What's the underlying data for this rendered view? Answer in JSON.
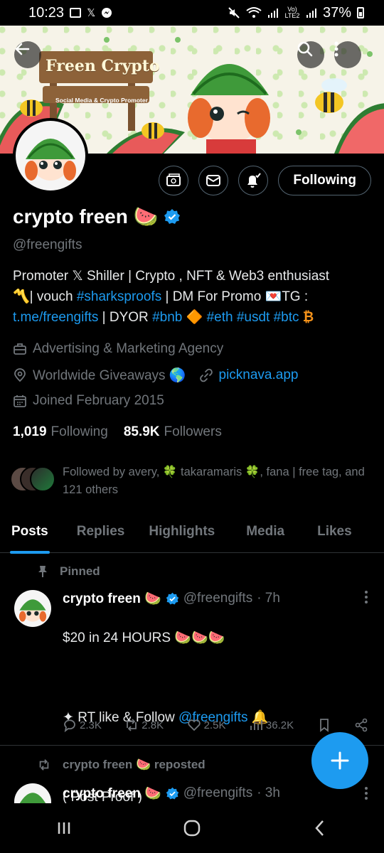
{
  "status_bar": {
    "time": "10:23",
    "carrier": "Vo) LTE2",
    "battery": "37%"
  },
  "banner": {
    "title": "Freen Crypto",
    "subtitle": "Social Media & Crypto Promoter"
  },
  "profile": {
    "display_name": "crypto freen 🍉",
    "handle": "@freengifts",
    "following_button": "Following",
    "bio_line1": "Promoter 𝕏 Shiller | Crypto , NFT & Web3 enthusiast",
    "bio_vouch_pre": "〽️| vouch ",
    "bio_vouch_tag": "#sharksproofs",
    "bio_vouch_post": " | DM For Promo 💌TG :",
    "bio_tg_link": "t.me/freengifts",
    "bio_dyor": " | DYOR ",
    "bio_tag_bnb": "#bnb",
    "bio_bnb_emoji": " 🔶 ",
    "bio_tag_eth": "#eth",
    "bio_tag_usdt": "#usdt",
    "bio_tag_btc": "#btc",
    "bio_btc_emoji": " ₿",
    "category": "Advertising & Marketing Agency",
    "location": "Worldwide Giveaways 🌎",
    "website": "picknava.app",
    "joined": "Joined February 2015",
    "following_count": "1,019",
    "following_label": "Following",
    "followers_count": "85.9K",
    "followers_label": "Followers",
    "followed_by": "Followed by avery, 🍀 takaramaris 🍀, fana | free tag, and 121 others"
  },
  "tabs": [
    "Posts",
    "Replies",
    "Highlights",
    "Media",
    "Likes"
  ],
  "posts": [
    {
      "context": "Pinned",
      "name": "crypto freen 🍉",
      "handle": "@freengifts",
      "time": "· 7h",
      "body_line1": "$20 in 24 HOURS 🍉🍉🍉",
      "body_line2_pre": "✦ RT like & Follow ",
      "body_line2_link": "@freengifts",
      "body_line2_post": " 🔔",
      "body_line3": "( Post Proof )",
      "replies": "2.3K",
      "reposts": "2.8K",
      "likes": "2.5K",
      "views": "36.2K"
    },
    {
      "context": "crypto freen 🍉 reposted",
      "name": "crypto freen 🍉",
      "handle": "@freengifts",
      "time": "· 3h"
    }
  ],
  "colors": {
    "accent": "#1d9bf0",
    "muted": "#71767b",
    "background": "#000000"
  }
}
